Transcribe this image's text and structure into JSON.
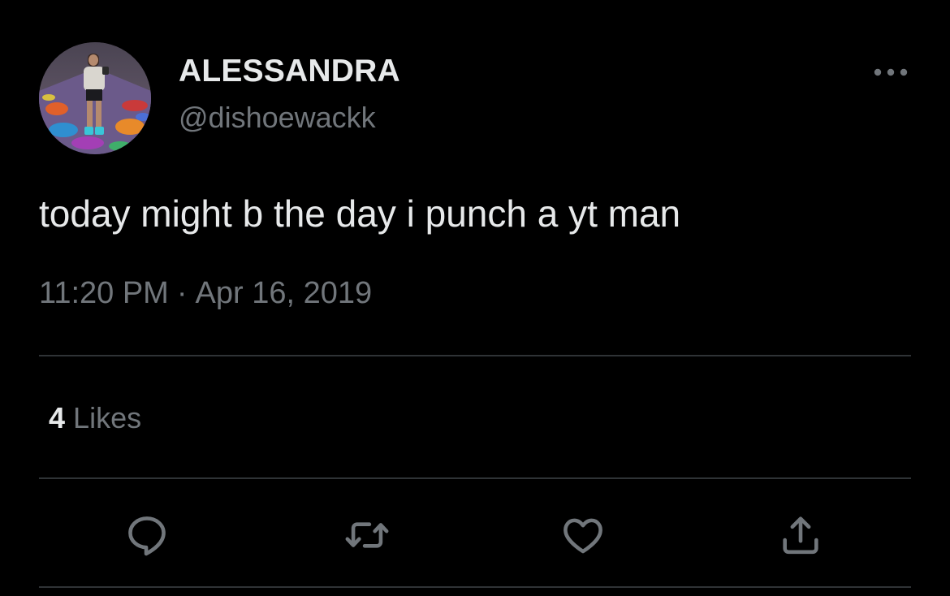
{
  "tweet": {
    "author": {
      "display_name": "ALESSANDRA",
      "handle": "@dishoewackk",
      "avatar": "profile-photo"
    },
    "text": "today might b the day i punch a yt man",
    "time": "11:20 PM",
    "separator": "·",
    "date": "Apr 16, 2019",
    "likes_count": "4",
    "likes_label": "Likes"
  },
  "actions": {
    "more": "more-icon",
    "reply": "reply-icon",
    "retweet": "retweet-icon",
    "like": "heart-icon",
    "share": "share-icon"
  },
  "colors": {
    "background": "#000000",
    "primary_text": "#e7e9ea",
    "secondary_text": "#71767b",
    "divider": "#2f3336"
  }
}
